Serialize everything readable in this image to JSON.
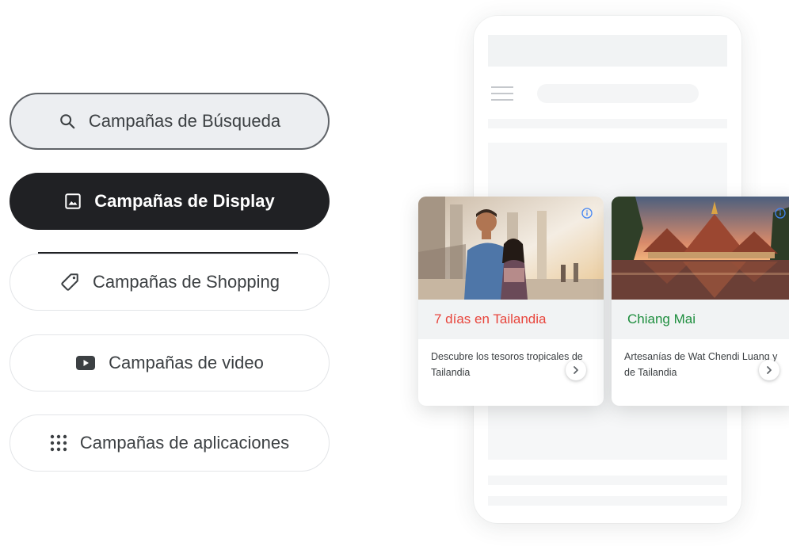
{
  "campaigns": {
    "search_label": "Campañas de Búsqueda",
    "display_label": "Campañas de Display",
    "shopping_label": "Campañas de Shopping",
    "video_label": "Campañas de video",
    "apps_label": "Campañas de aplicaciones",
    "selected": "Campañas de Display"
  },
  "icons": {
    "search": "search-icon",
    "display": "image-icon",
    "shopping": "tag-icon",
    "video": "youtube-icon",
    "apps": "grid-dots-icon",
    "info": "info-icon",
    "next": "chevron-right-icon",
    "menu": "hamburger-menu-icon"
  },
  "ads": [
    {
      "headline": "7 días en Tailandia",
      "description": "Descubre los tesoros tropicales de Tailandia",
      "headline_color": "#e8453c"
    },
    {
      "headline": "Chiang Mai",
      "description": "Artesanías de Wat Chendi Luang y de Tailandia",
      "headline_color": "#1e8e3e"
    }
  ],
  "colors": {
    "selected_bg": "#202124",
    "search_bg": "#eceef1",
    "text": "#3c4043",
    "info_blue": "#4285f4"
  }
}
